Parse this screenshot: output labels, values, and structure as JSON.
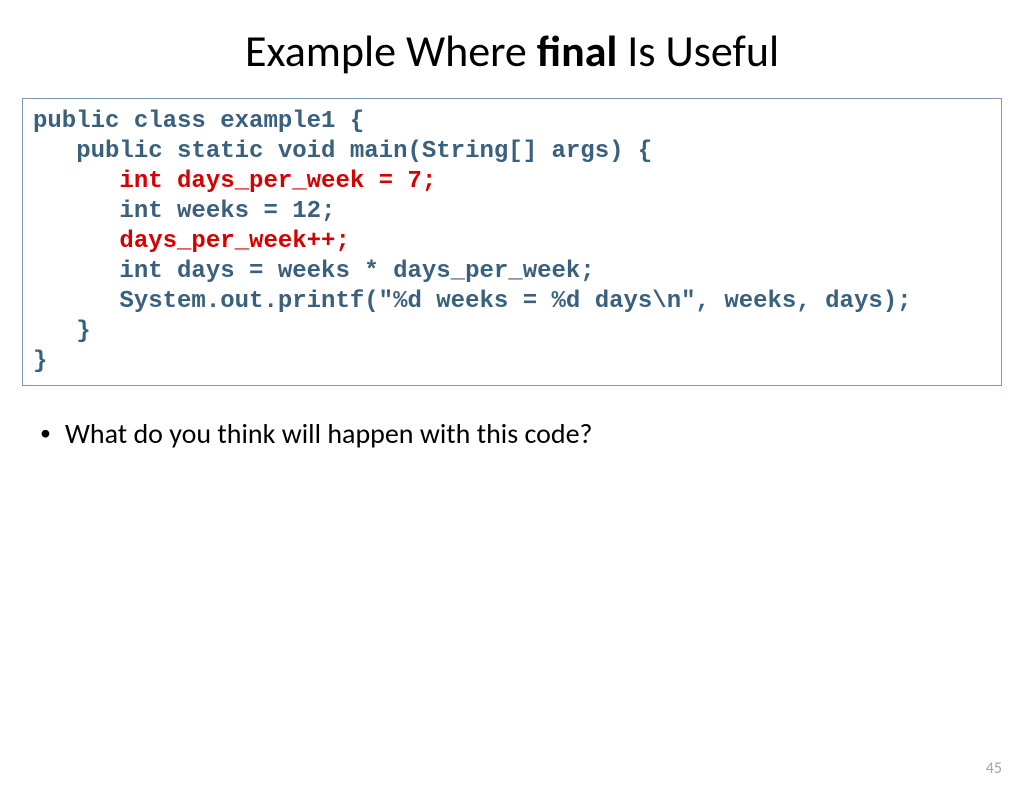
{
  "title": {
    "prefix": "Example Where ",
    "bold": "final",
    "suffix": " Is Useful"
  },
  "code": {
    "line1": "public class example1 {",
    "line2_indent": "   ",
    "line2": "public static void main(String[] args) {",
    "line3_indent": "      ",
    "line3_hl": "int days_per_week = 7;",
    "line4_indent": "      ",
    "line4": "int weeks = 12;",
    "line5_indent": "      ",
    "line5_hl": "days_per_week++;",
    "line6_indent": "      ",
    "line6": "int days = weeks * days_per_week;",
    "line7_indent": "      ",
    "line7": "System.out.printf(\"%d weeks = %d days\\n\", weeks, days);",
    "line8": "   }",
    "line9": "}"
  },
  "bullet1": "What do you think will happen with this code?",
  "page_number": "45"
}
